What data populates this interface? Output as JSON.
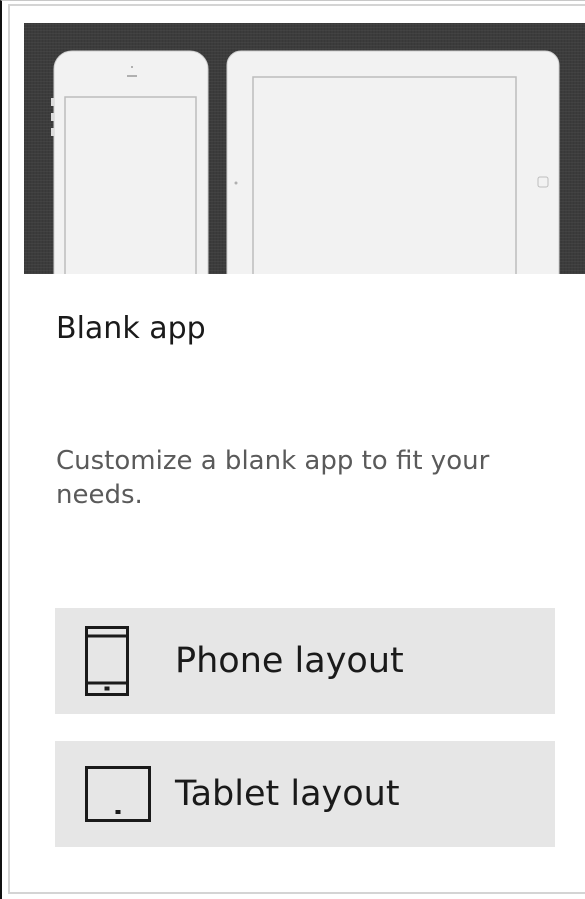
{
  "template": {
    "title": "Blank app",
    "description": "Customize a blank app to fit your needs."
  },
  "buttons": {
    "phone": {
      "label": "Phone layout",
      "icon": "phone-icon"
    },
    "tablet": {
      "label": "Tablet layout",
      "icon": "tablet-icon"
    }
  },
  "colors": {
    "preview_background": "#3c3c3c",
    "device_fill": "#f2f2f2",
    "button_background": "#e6e6e6",
    "title_text": "#1a1a1a",
    "description_text": "#5a5a5a"
  }
}
